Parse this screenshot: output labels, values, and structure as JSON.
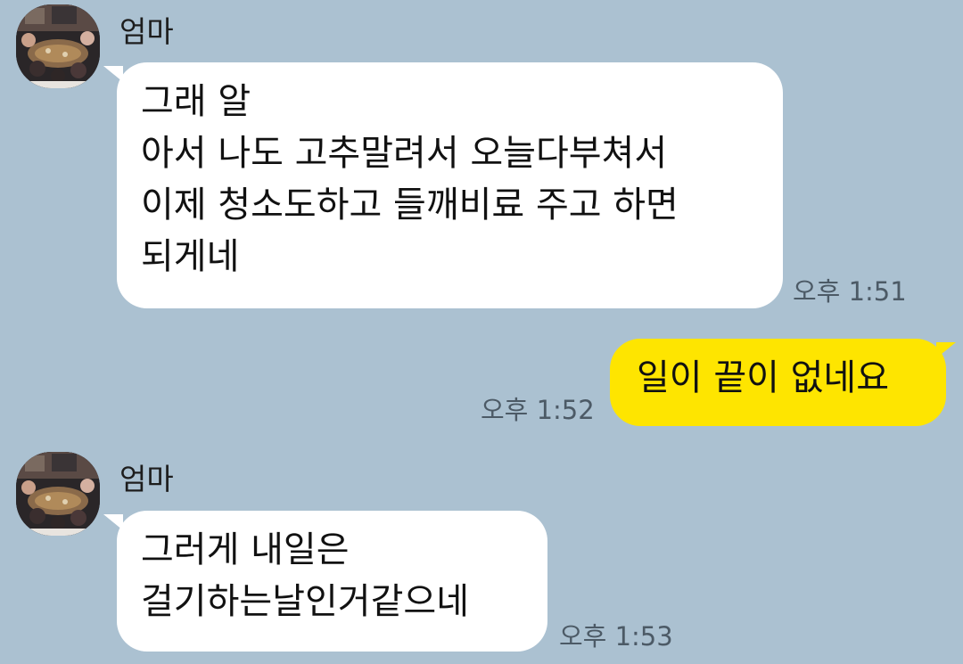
{
  "messages": [
    {
      "sender": "엄마",
      "lines": [
        "그래 알",
        "아서 나도 고추말려서 오늘다부쳐서",
        "이제 청소도하고 들깨비료 주고 하면",
        "되게네"
      ],
      "time": "오후 1:51"
    },
    {
      "sender": "me",
      "lines": [
        "일이 끝이 없네요"
      ],
      "time": "오후 1:52"
    },
    {
      "sender": "엄마",
      "lines": [
        "그러게 내일은",
        "걸기하는날인거같으네"
      ],
      "time": "오후 1:53"
    }
  ],
  "colors": {
    "background": "#abc1d1",
    "incoming_bubble": "#ffffff",
    "outgoing_bubble": "#fee500",
    "timestamp": "#4c5a66"
  },
  "icons": {
    "avatar": "profile-photo-group-dinner"
  }
}
